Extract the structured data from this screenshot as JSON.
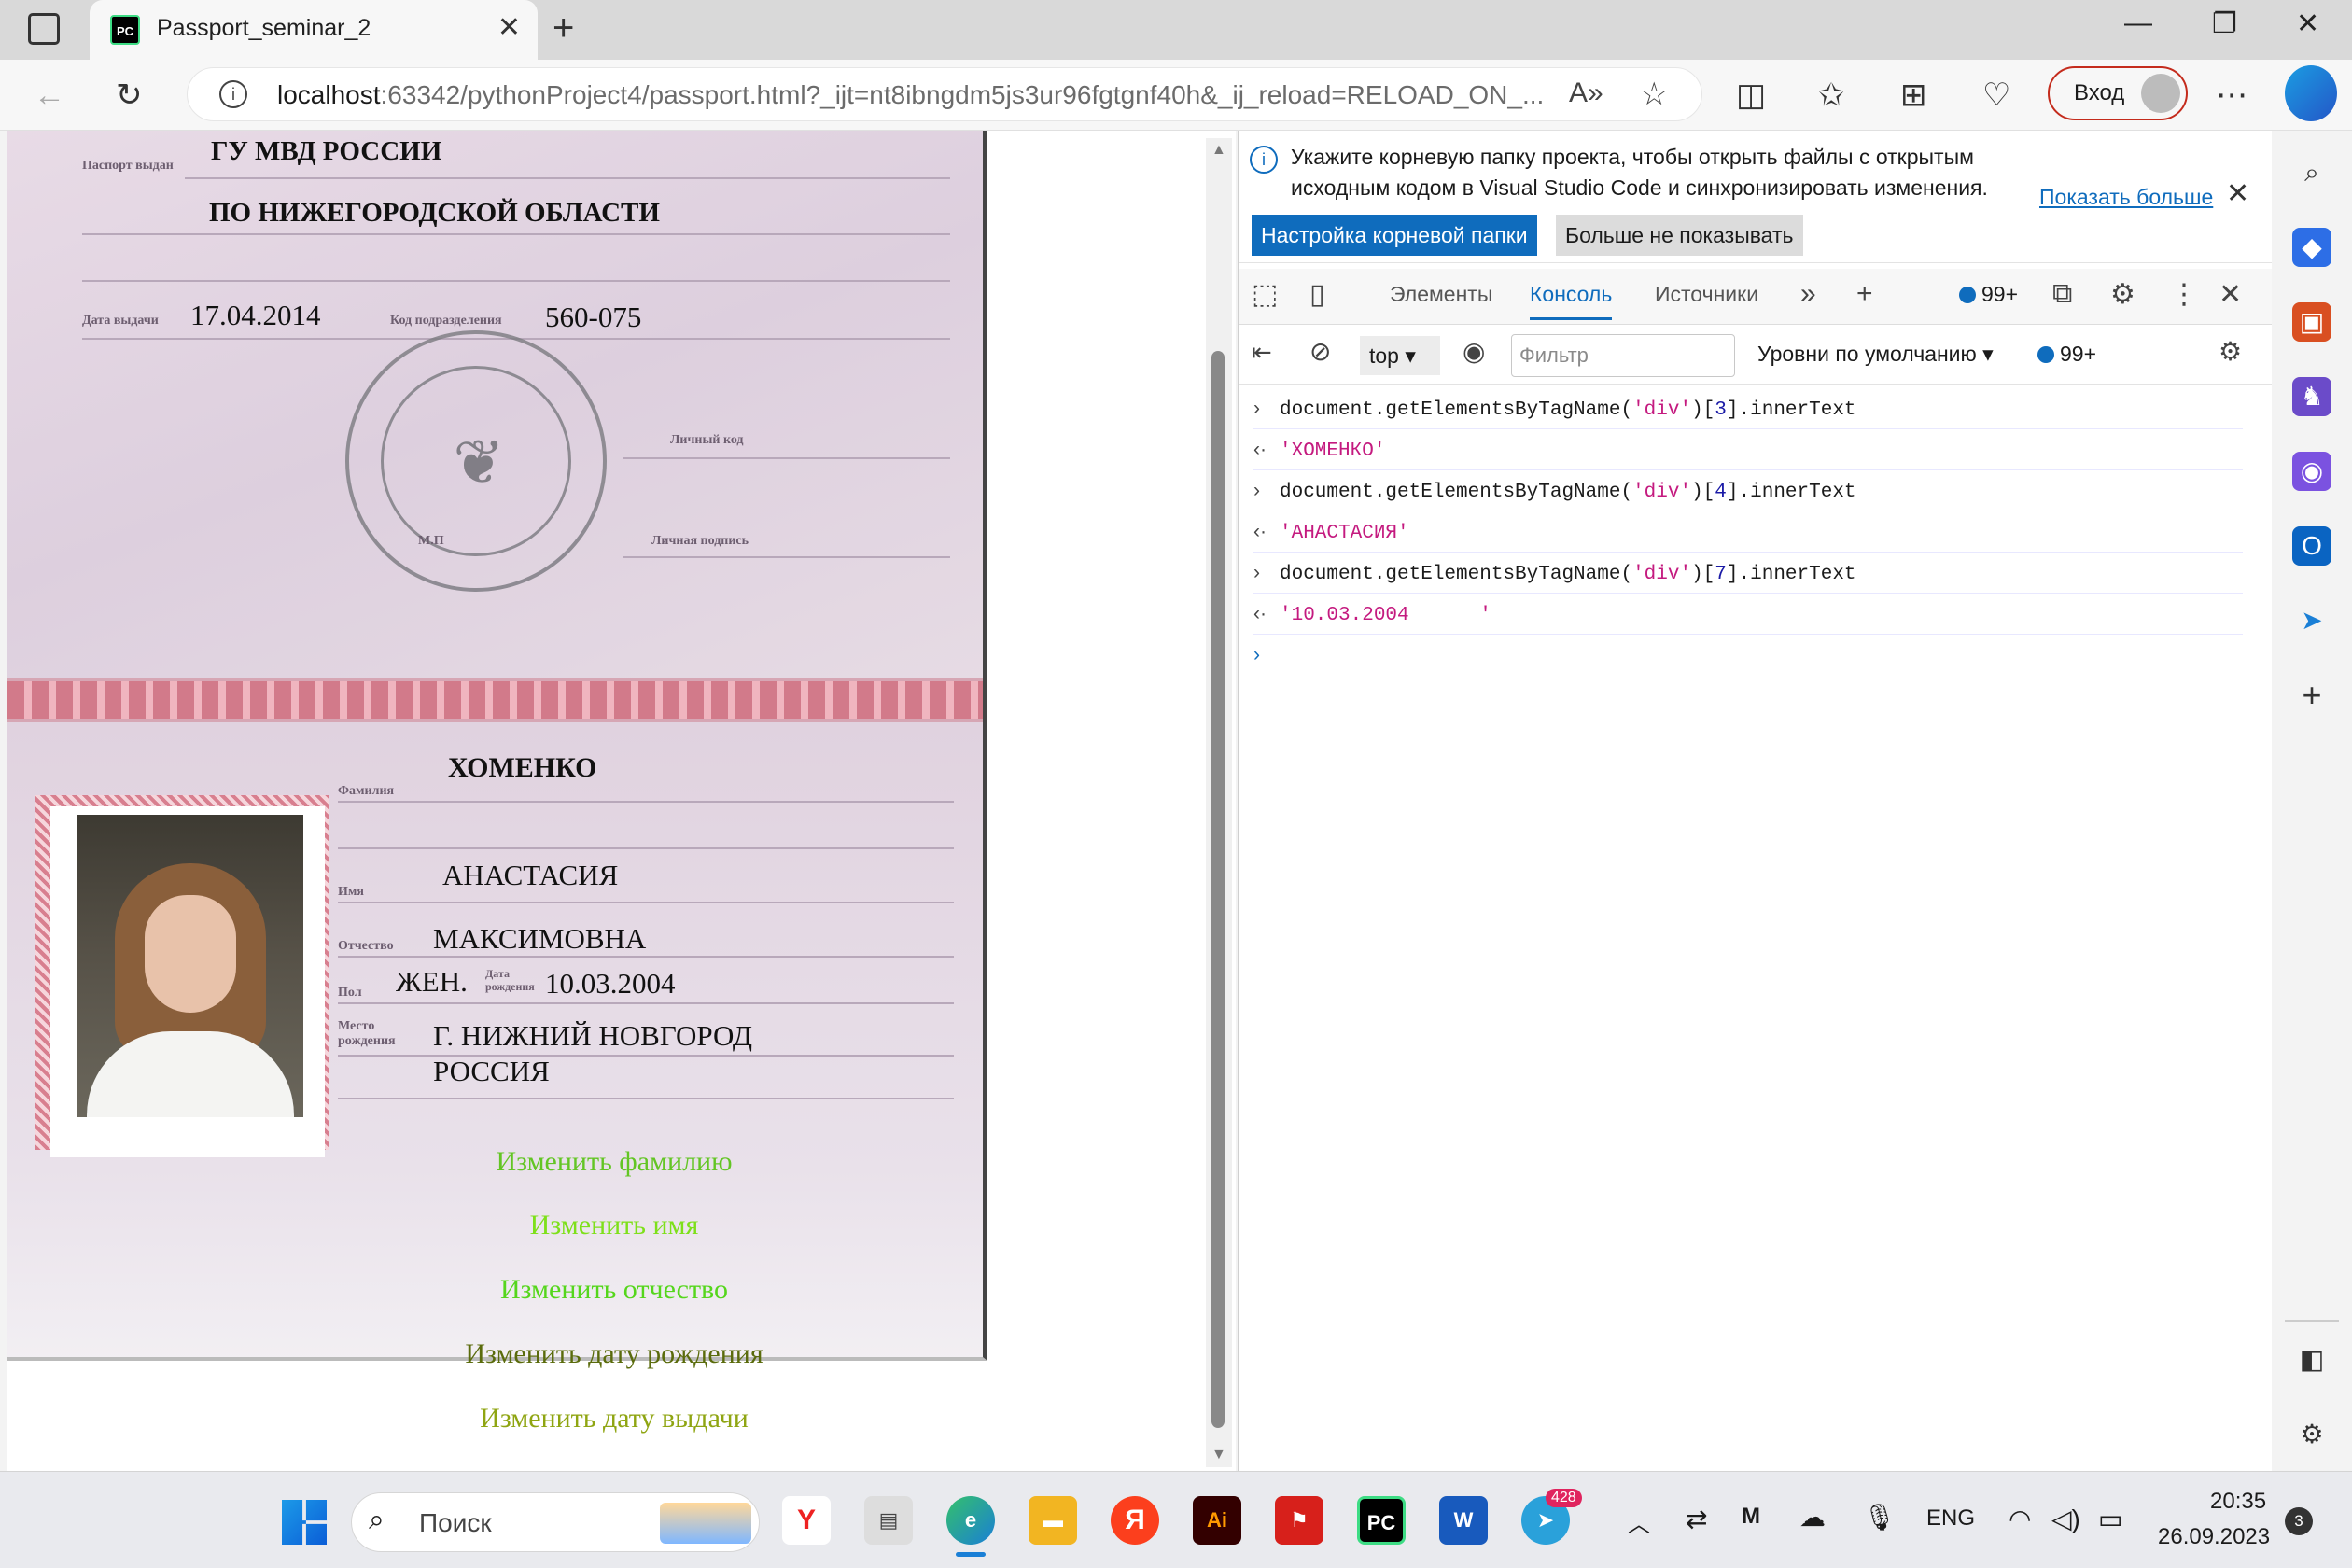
{
  "browser": {
    "tab_title": "Passport_seminar_2",
    "url_host": "localhost",
    "url_rest": ":63342/pythonProject4/passport.html?_ijt=nt8ibngdm5js3ur96fgtgnf40h&_ij_reload=RELOAD_ON_...",
    "login_label": "Вход"
  },
  "passport": {
    "issuer_line1": "ГУ МВД РОССИИ",
    "issuer_line2": "ПО НИЖЕГОРОДСКОЙ ОБЛАСТИ",
    "issued_by_label": "Паспорт выдан",
    "issue_date_label": "Дата выдачи",
    "issue_date": "17.04.2014",
    "dept_code_label": "Код подразделения",
    "dept_code": "560-075",
    "personal_code_label": "Личный код",
    "signature_label": "Личная подпись",
    "mp_label": "М.П",
    "surname_label": "Фамилия",
    "surname": "ХОМЕНКО",
    "name_label": "Имя",
    "name": "АНАСТАСИЯ",
    "patronymic_label": "Отчество",
    "patronymic": "МАКСИМОВНА",
    "sex_label": "Пол",
    "sex": "ЖЕН.",
    "dob_label": "Дата рождения",
    "dob": "10.03.2004",
    "birthplace_label": "Место рождения",
    "birthplace_line1": "Г. НИЖНИЙ НОВГОРОД",
    "birthplace_line2": "РОССИЯ"
  },
  "links": {
    "change_surname": "Изменить фамилию",
    "change_name": "Изменить имя",
    "change_patronymic": "Изменить отчество",
    "change_dob": "Изменить дату рождения",
    "change_issue_date": "Изменить дату выдачи"
  },
  "devtools": {
    "info_message": "Укажите корневую папку проекта, чтобы открыть файлы с открытым исходным кодом в Visual Studio Code и синхронизировать изменения.",
    "info_more": "Показать больше",
    "btn_set_root": "Настройка корневой папки",
    "btn_dont_show": "Больше не показывать",
    "tabs": [
      "Элементы",
      "Консоль",
      "Источники"
    ],
    "issues_count": "99+",
    "context": "top",
    "filter_placeholder": "Фильтр",
    "levels": "Уровни по умолчанию",
    "console": [
      {
        "type": "input",
        "pre": "document.getElementsByTagName(",
        "arg": "'div'",
        "idx": "3",
        "post": ".innerText"
      },
      {
        "type": "result",
        "text": "'ХОМЕНКО'"
      },
      {
        "type": "input",
        "pre": "document.getElementsByTagName(",
        "arg": "'div'",
        "idx": "4",
        "post": ".innerText"
      },
      {
        "type": "result",
        "text": "'АНАСТАСИЯ'"
      },
      {
        "type": "input",
        "pre": "document.getElementsByTagName(",
        "arg": "'div'",
        "idx": "7",
        "post": ".innerText"
      },
      {
        "type": "result",
        "text": "'10.03.2004      '"
      }
    ]
  },
  "taskbar": {
    "search_placeholder": "Поиск",
    "telegram_badge": "428",
    "lang": "ENG",
    "time": "20:35",
    "date": "26.09.2023",
    "notif_count": "3"
  },
  "colors": {
    "accent": "#0f6cbd",
    "link_green": "#6dd11a",
    "link_olive": "#7a8d12",
    "login_border": "#c42b1c"
  }
}
